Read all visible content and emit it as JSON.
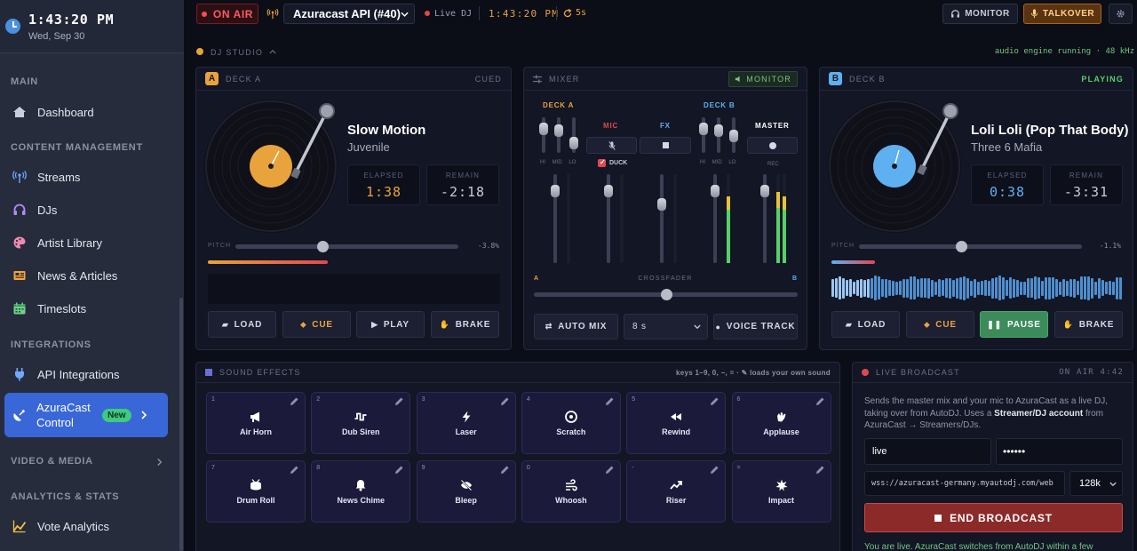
{
  "sidebar": {
    "time": "1:43:20 PM",
    "date": "Wed, Sep 30",
    "sections": {
      "main": "MAIN",
      "content": "CONTENT MANAGEMENT",
      "integrations": "INTEGRATIONS",
      "video": "VIDEO & MEDIA",
      "analytics": "ANALYTICS & STATS"
    },
    "items": {
      "dashboard": "Dashboard",
      "streams": "Streams",
      "djs": "DJs",
      "artists": "Artist Library",
      "news": "News & Articles",
      "timeslots": "Timeslots",
      "api": "API Integrations",
      "azuracast": "AzuraCast Control",
      "azuracast_badge": "New",
      "vote": "Vote Analytics"
    }
  },
  "topbar": {
    "on_air": "ON AIR",
    "station": "Azuracast API (#40)",
    "live_dj": "Live DJ",
    "clock": "1:43:20 PM",
    "interval": "5s",
    "monitor": "MONITOR",
    "talkover": "TALKOVER"
  },
  "studio": {
    "title": "DJ STUDIO",
    "status": "audio engine running · 48 kHz"
  },
  "deck_a": {
    "badge": "A",
    "title": "DECK A",
    "state": "CUED",
    "track": "Slow Motion",
    "artist": "Juvenile",
    "elapsed_label": "ELAPSED",
    "elapsed": "1:38",
    "remain_label": "REMAIN",
    "remain": "-2:18",
    "pitch_label": "PITCH",
    "pitch": "-3.8%",
    "pitch_level": 0.39,
    "progress": 0.41,
    "buttons": {
      "load": "LOAD",
      "cue": "CUE",
      "play": "PLAY",
      "brake": "BRAKE"
    },
    "color": "#e8a33c"
  },
  "deck_b": {
    "badge": "B",
    "title": "DECK B",
    "state": "PLAYING",
    "track": "Loli Loli (Pop That Body)",
    "artist": "Three 6 Mafia",
    "elapsed_label": "ELAPSED",
    "elapsed": "0:38",
    "remain_label": "REMAIN",
    "remain": "-3:31",
    "pitch_label": "PITCH",
    "pitch": "-1.1%",
    "pitch_level": 0.46,
    "progress": 0.15,
    "buttons": {
      "load": "LOAD",
      "cue": "CUE",
      "pause": "PAUSE",
      "brake": "BRAKE"
    },
    "color": "#5fb0f0"
  },
  "mixer": {
    "title": "MIXER",
    "monitor": "MONITOR",
    "deck_a": "DECK A",
    "deck_b": "DECK B",
    "mic": "MIC",
    "fx": "FX",
    "master": "MASTER",
    "duck": "DUCK",
    "eq": [
      "HI",
      "MID",
      "LO"
    ],
    "rec": "REC",
    "crossfader": "CROSSFADER",
    "cf_a": "A",
    "cf_b": "B",
    "crossfader_level": 0.5,
    "auto_mix": "AUTO MIX",
    "fade_time": "8 s",
    "voice_track": "VOICE TRACK"
  },
  "effects": {
    "title": "SOUND EFFECTS",
    "hint": "keys 1–9, 0, −, = · ✎ loads your own sound",
    "pads": [
      {
        "key": "1",
        "label": "Air Horn",
        "icon": "megaphone-icon"
      },
      {
        "key": "2",
        "label": "Dub Siren",
        "icon": "siren-wave-icon"
      },
      {
        "key": "3",
        "label": "Laser",
        "icon": "bolt-icon"
      },
      {
        "key": "4",
        "label": "Scratch",
        "icon": "vinyl-icon"
      },
      {
        "key": "5",
        "label": "Rewind",
        "icon": "rewind-icon"
      },
      {
        "key": "6",
        "label": "Applause",
        "icon": "clap-icon"
      },
      {
        "key": "7",
        "label": "Drum Roll",
        "icon": "drum-icon"
      },
      {
        "key": "8",
        "label": "News Chime",
        "icon": "bell-icon"
      },
      {
        "key": "9",
        "label": "Bleep",
        "icon": "mute-icon"
      },
      {
        "key": "0",
        "label": "Whoosh",
        "icon": "wind-icon"
      },
      {
        "key": "-",
        "label": "Riser",
        "icon": "trend-up-icon"
      },
      {
        "key": "=",
        "label": "Impact",
        "icon": "burst-icon"
      }
    ]
  },
  "broadcast": {
    "title": "LIVE BROADCAST",
    "status": "ON AIR 4:42",
    "desc_1": "Sends the master mix and your mic to AzuraCast as a live DJ, taking over from AutoDJ. Uses a ",
    "desc_bold": "Streamer/DJ account",
    "desc_2": " from AzuraCast → Streamers/DJs.",
    "username": "live",
    "password": "••••••",
    "url": "wss://azuracast-germany.myautodj.com/web",
    "bitrate": "128k",
    "end": "END BROADCAST",
    "note": "You are live. AzuraCast switches from AutoDJ within a few"
  }
}
